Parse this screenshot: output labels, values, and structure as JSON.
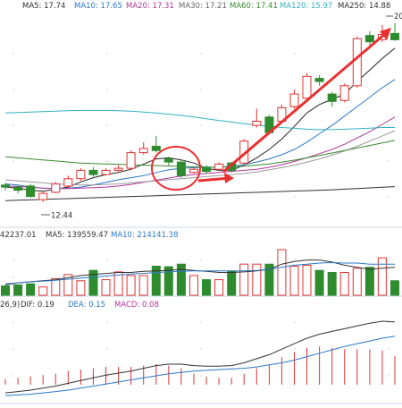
{
  "ma_legend": [
    {
      "label": "MA5: 17.74",
      "color": "#333333"
    },
    {
      "label": "MA10: 17.65",
      "color": "#2a78c8"
    },
    {
      "label": "MA20: 17.31",
      "color": "#b3359b"
    },
    {
      "label": "MA30: 17.21",
      "color": "#666666"
    },
    {
      "label": "MA60: 17.41",
      "color": "#3a8a2e"
    },
    {
      "label": "MA120: 15.97",
      "color": "#33b0c8"
    },
    {
      "label": "MA250: 14.88",
      "color": "#333333"
    }
  ],
  "vol_legend": [
    {
      "label": "42237.01",
      "color": "#333333"
    },
    {
      "label": "MA5: 139559.47",
      "color": "#333333"
    },
    {
      "label": "MA10: 214141.38",
      "color": "#2a78c8"
    }
  ],
  "macd_legend": [
    {
      "label": "26,9)",
      "color": "#333333"
    },
    {
      "label": "DIF: 0.19",
      "color": "#333333"
    },
    {
      "label": "DEA: 0.15",
      "color": "#2a78c8"
    },
    {
      "label": "MACD: 0.08",
      "color": "#b3359b"
    }
  ],
  "labels": {
    "low_price": "12.44",
    "high_price": "20"
  },
  "colors": {
    "up": "#e03030",
    "down": "#2e8b2e",
    "arrow": "#e83030",
    "circle": "#e83030"
  },
  "chart_data": {
    "type": "candlestick",
    "price_range": [
      11.4,
      21.5
    ],
    "candles": [
      {
        "o": 13.25,
        "c": 13.15,
        "h": 13.35,
        "l": 13.0
      },
      {
        "o": 13.15,
        "c": 13.0,
        "h": 13.25,
        "l": 12.85
      },
      {
        "o": 13.2,
        "c": 12.7,
        "h": 13.3,
        "l": 12.65
      },
      {
        "o": 12.55,
        "c": 12.85,
        "h": 12.95,
        "l": 12.44
      },
      {
        "o": 12.9,
        "c": 13.3,
        "h": 13.4,
        "l": 12.85
      },
      {
        "o": 13.2,
        "c": 13.55,
        "h": 13.7,
        "l": 13.1
      },
      {
        "o": 13.55,
        "c": 13.95,
        "h": 14.05,
        "l": 13.45
      },
      {
        "o": 13.95,
        "c": 13.75,
        "h": 14.1,
        "l": 13.65
      },
      {
        "o": 13.75,
        "c": 13.95,
        "h": 14.05,
        "l": 13.7
      },
      {
        "o": 13.95,
        "c": 14.05,
        "h": 14.2,
        "l": 13.9
      },
      {
        "o": 14.05,
        "c": 14.8,
        "h": 14.9,
        "l": 13.95
      },
      {
        "o": 14.8,
        "c": 15.0,
        "h": 15.3,
        "l": 14.7
      },
      {
        "o": 15.1,
        "c": 14.9,
        "h": 15.6,
        "l": 14.8
      },
      {
        "o": 14.5,
        "c": 14.35,
        "h": 14.6,
        "l": 14.2
      },
      {
        "o": 14.35,
        "c": 13.7,
        "h": 14.45,
        "l": 13.6
      },
      {
        "o": 13.85,
        "c": 14.0,
        "h": 14.1,
        "l": 13.8
      },
      {
        "o": 14.1,
        "c": 13.9,
        "h": 14.2,
        "l": 13.8
      },
      {
        "o": 14.0,
        "c": 14.25,
        "h": 14.35,
        "l": 13.95
      },
      {
        "o": 14.3,
        "c": 13.95,
        "h": 14.35,
        "l": 13.85
      },
      {
        "o": 14.3,
        "c": 15.35,
        "h": 15.45,
        "l": 14.25
      },
      {
        "o": 16.1,
        "c": 16.3,
        "h": 16.9,
        "l": 16.0
      },
      {
        "o": 16.5,
        "c": 15.75,
        "h": 16.6,
        "l": 15.65
      },
      {
        "o": 16.3,
        "c": 16.95,
        "h": 17.1,
        "l": 16.2
      },
      {
        "o": 17.0,
        "c": 17.6,
        "h": 17.8,
        "l": 16.9
      },
      {
        "o": 17.4,
        "c": 18.45,
        "h": 18.6,
        "l": 17.3
      },
      {
        "o": 18.35,
        "c": 18.2,
        "h": 18.5,
        "l": 18.0
      },
      {
        "o": 17.6,
        "c": 17.25,
        "h": 17.7,
        "l": 17.0
      },
      {
        "o": 17.3,
        "c": 18.0,
        "h": 18.1,
        "l": 17.2
      },
      {
        "o": 18.0,
        "c": 20.25,
        "h": 20.35,
        "l": 17.9
      },
      {
        "o": 20.4,
        "c": 20.1,
        "h": 20.6,
        "l": 19.95
      },
      {
        "o": 20.2,
        "c": 20.45,
        "h": 20.9,
        "l": 20.1
      },
      {
        "o": 20.5,
        "c": 20.2,
        "h": 21.0,
        "l": 20.15
      }
    ],
    "volume_max": 1.0,
    "volumes": [
      0.18,
      0.2,
      0.22,
      0.16,
      0.32,
      0.4,
      0.28,
      0.48,
      0.3,
      0.45,
      0.38,
      0.38,
      0.56,
      0.55,
      0.6,
      0.38,
      0.3,
      0.3,
      0.46,
      0.6,
      0.6,
      0.6,
      0.88,
      0.56,
      0.58,
      0.48,
      0.44,
      0.44,
      0.52,
      0.54,
      0.72,
      0.28
    ],
    "volume_ma5": [
      0.2,
      0.24,
      0.26,
      0.28,
      0.3,
      0.34,
      0.38,
      0.4,
      0.42,
      0.44,
      0.44,
      0.46,
      0.47,
      0.48,
      0.5,
      0.48,
      0.46,
      0.44,
      0.44,
      0.45,
      0.47,
      0.5,
      0.6,
      0.65,
      0.68,
      0.68,
      0.64,
      0.58,
      0.54,
      0.5,
      0.52,
      0.54
    ],
    "volume_ma10": [
      0.22,
      0.24,
      0.26,
      0.27,
      0.29,
      0.31,
      0.33,
      0.35,
      0.37,
      0.39,
      0.41,
      0.42,
      0.44,
      0.45,
      0.46,
      0.47,
      0.47,
      0.47,
      0.47,
      0.47,
      0.48,
      0.5,
      0.54,
      0.58,
      0.6,
      0.62,
      0.63,
      0.62,
      0.62,
      0.6,
      0.6,
      0.6
    ],
    "macd_range": [
      -0.25,
      1.1
    ],
    "macd_dif": [
      -0.12,
      -0.1,
      -0.08,
      -0.05,
      -0.02,
      0.02,
      0.06,
      0.1,
      0.14,
      0.17,
      0.2,
      0.24,
      0.28,
      0.3,
      0.3,
      0.28,
      0.27,
      0.27,
      0.28,
      0.32,
      0.38,
      0.44,
      0.52,
      0.6,
      0.68,
      0.74,
      0.78,
      0.82,
      0.86,
      0.9,
      0.93,
      0.92
    ],
    "macd_dea": [
      -0.16,
      -0.15,
      -0.14,
      -0.12,
      -0.1,
      -0.08,
      -0.05,
      -0.02,
      0.01,
      0.04,
      0.07,
      0.1,
      0.13,
      0.16,
      0.18,
      0.2,
      0.21,
      0.22,
      0.23,
      0.24,
      0.26,
      0.29,
      0.32,
      0.36,
      0.41,
      0.46,
      0.51,
      0.56,
      0.6,
      0.64,
      0.68,
      0.71
    ],
    "macd_hist": [
      0.08,
      0.1,
      0.12,
      0.14,
      0.16,
      0.2,
      0.22,
      0.24,
      0.26,
      0.26,
      0.26,
      0.28,
      0.3,
      0.28,
      0.24,
      0.16,
      0.12,
      0.1,
      0.1,
      0.16,
      0.24,
      0.3,
      0.4,
      0.48,
      0.54,
      0.56,
      0.54,
      0.52,
      0.52,
      0.52,
      0.5,
      0.42
    ],
    "moving_averages": [
      {
        "name": "MA5",
        "color": "#222222",
        "values": [
          13.15,
          13.1,
          13.0,
          12.95,
          13.05,
          13.15,
          13.4,
          13.6,
          13.75,
          13.85,
          14.0,
          14.25,
          14.5,
          14.55,
          14.45,
          14.3,
          14.05,
          13.95,
          13.95,
          14.2,
          14.55,
          14.95,
          15.45,
          16.05,
          16.7,
          17.1,
          17.35,
          17.6,
          18.2,
          18.75,
          19.3,
          19.8
        ]
      },
      {
        "name": "MA10",
        "color": "#2a78c8",
        "values": [
          13.3,
          13.25,
          13.15,
          13.1,
          13.08,
          13.1,
          13.15,
          13.25,
          13.38,
          13.5,
          13.6,
          13.7,
          13.85,
          13.98,
          14.05,
          14.08,
          14.1,
          14.1,
          14.15,
          14.22,
          14.35,
          14.5,
          14.7,
          14.95,
          15.3,
          15.7,
          16.1,
          16.55,
          17.0,
          17.45,
          17.9,
          18.3
        ]
      },
      {
        "name": "MA20",
        "color": "#b3359b",
        "values": [
          13.2,
          13.18,
          13.15,
          13.1,
          13.08,
          13.08,
          13.1,
          13.12,
          13.15,
          13.2,
          13.28,
          13.38,
          13.48,
          13.58,
          13.68,
          13.75,
          13.8,
          13.85,
          13.9,
          13.95,
          14.0,
          14.1,
          14.22,
          14.38,
          14.55,
          14.75,
          14.95,
          15.2,
          15.5,
          15.8,
          16.15,
          16.5
        ]
      },
      {
        "name": "MA30",
        "color": "#9a9a9a",
        "values": [
          13.5,
          13.45,
          13.4,
          13.35,
          13.3,
          13.28,
          13.25,
          13.25,
          13.28,
          13.3,
          13.35,
          13.4,
          13.45,
          13.5,
          13.55,
          13.6,
          13.65,
          13.7,
          13.75,
          13.8,
          13.88,
          13.98,
          14.08,
          14.2,
          14.35,
          14.5,
          14.68,
          14.88,
          15.1,
          15.35,
          15.6,
          15.85
        ]
      },
      {
        "name": "MA60",
        "color": "#3a8a2e",
        "values": [
          14.6,
          14.55,
          14.5,
          14.45,
          14.4,
          14.35,
          14.3,
          14.28,
          14.26,
          14.24,
          14.22,
          14.2,
          14.18,
          14.16,
          14.14,
          14.12,
          14.1,
          14.1,
          14.12,
          14.15,
          14.2,
          14.26,
          14.34,
          14.44,
          14.55,
          14.66,
          14.78,
          14.9,
          15.02,
          15.14,
          15.26,
          15.38
        ]
      },
      {
        "name": "MA120",
        "color": "#33b0c8",
        "values": [
          16.7,
          16.72,
          16.74,
          16.76,
          16.78,
          16.8,
          16.82,
          16.82,
          16.82,
          16.8,
          16.78,
          16.74,
          16.7,
          16.64,
          16.58,
          16.5,
          16.42,
          16.34,
          16.26,
          16.18,
          16.12,
          16.06,
          16.0,
          15.96,
          15.92,
          15.9,
          15.9,
          15.92,
          15.94,
          15.97,
          16.0,
          16.0
        ]
      },
      {
        "name": "MA250",
        "color": "#333333",
        "values": [
          12.5,
          12.52,
          12.54,
          12.56,
          12.58,
          12.6,
          12.62,
          12.64,
          12.66,
          12.68,
          12.7,
          12.72,
          12.74,
          12.76,
          12.78,
          12.8,
          12.82,
          12.84,
          12.86,
          12.88,
          12.9,
          12.92,
          12.94,
          12.96,
          12.98,
          13.0,
          13.02,
          13.05,
          13.08,
          13.11,
          13.14,
          13.17
        ]
      }
    ]
  }
}
